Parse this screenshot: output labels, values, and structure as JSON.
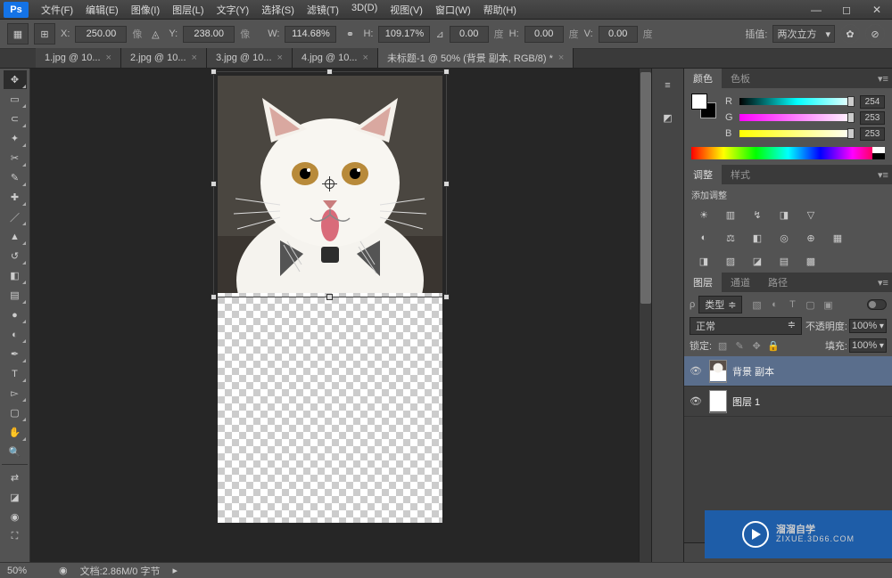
{
  "app": {
    "logo": "Ps"
  },
  "menu": [
    "文件(F)",
    "编辑(E)",
    "图像(I)",
    "图层(L)",
    "文字(Y)",
    "选择(S)",
    "滤镜(T)",
    "3D(D)",
    "视图(V)",
    "窗口(W)",
    "帮助(H)"
  ],
  "options": {
    "x_label": "X:",
    "x_val": "250.00",
    "x_unit": "像",
    "y_label": "Y:",
    "y_val": "238.00",
    "y_unit": "像",
    "w_label": "W:",
    "w_val": "114.68%",
    "h_label": "H:",
    "h_val": "109.17%",
    "angle_sym": "⊿",
    "angle_val": "0.00",
    "angle_unit": "度",
    "hskew_label": "H:",
    "hskew_val": "0.00",
    "vskew_label": "V:",
    "vskew_val": "0.00",
    "skew_unit": "度",
    "interp_label": "插值:",
    "interp_val": "两次立方"
  },
  "tabs": [
    {
      "label": "1.jpg @ 10...",
      "active": false
    },
    {
      "label": "2.jpg @ 10...",
      "active": false
    },
    {
      "label": "3.jpg @ 10...",
      "active": false
    },
    {
      "label": "4.jpg @ 10...",
      "active": false
    },
    {
      "label": "未标题-1 @ 50% (背景 副本, RGB/8) *",
      "active": true
    }
  ],
  "color_panel": {
    "tab_color": "颜色",
    "tab_swatch": "色板",
    "r": {
      "label": "R",
      "val": "254"
    },
    "g": {
      "label": "G",
      "val": "253"
    },
    "b": {
      "label": "B",
      "val": "253"
    }
  },
  "adjust_panel": {
    "tab_adjust": "调整",
    "tab_style": "样式",
    "title": "添加调整"
  },
  "layers_panel": {
    "tab_layers": "图层",
    "tab_channels": "通道",
    "tab_paths": "路径",
    "kind_label": "类型",
    "blend_mode": "正常",
    "opacity_label": "不透明度:",
    "opacity_val": "100%",
    "lock_label": "锁定:",
    "fill_label": "填充:",
    "fill_val": "100%",
    "items": [
      {
        "name": "背景 副本",
        "selected": true
      },
      {
        "name": "图层 1",
        "selected": false
      }
    ]
  },
  "watermark": {
    "title": "溜溜自学",
    "sub": "ZIXUE.3D66.COM"
  },
  "status": {
    "zoom": "50%",
    "doc": "文档:2.86M/0 字节"
  }
}
